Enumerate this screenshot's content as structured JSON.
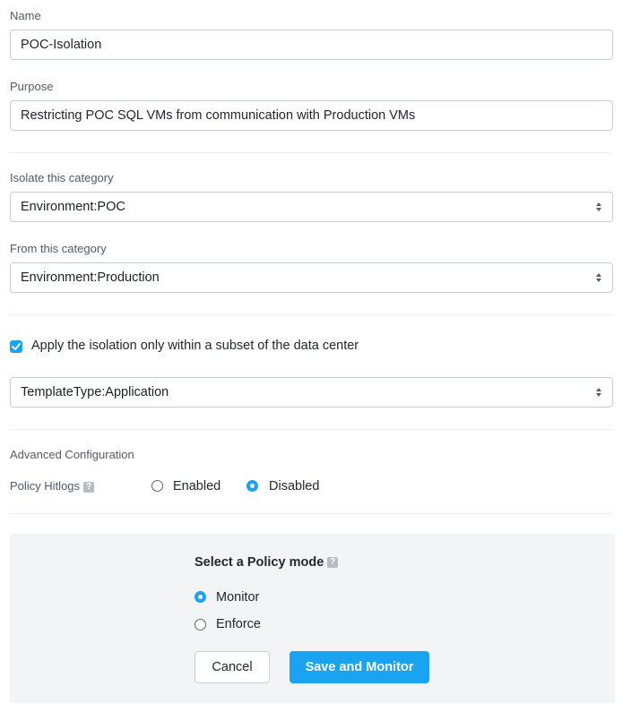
{
  "name": {
    "label": "Name",
    "value": "POC-Isolation"
  },
  "purpose": {
    "label": "Purpose",
    "value": "Restricting POC SQL VMs from communication with Production VMs"
  },
  "isolate": {
    "label": "Isolate this category",
    "value": "Environment:POC"
  },
  "from": {
    "label": "From this category",
    "value": "Environment:Production"
  },
  "subset": {
    "checked": true,
    "label": "Apply the isolation only within a subset of the data center",
    "value": "TemplateType:Application"
  },
  "advanced": {
    "heading": "Advanced Configuration",
    "hitlogs_label": "Policy Hitlogs",
    "help_icon": "question-icon",
    "options": [
      {
        "label": "Enabled",
        "selected": false
      },
      {
        "label": "Disabled",
        "selected": true
      }
    ]
  },
  "policy_mode": {
    "title": "Select a Policy mode",
    "options": [
      {
        "label": "Monitor",
        "selected": true
      },
      {
        "label": "Enforce",
        "selected": false
      }
    ],
    "cancel_label": "Cancel",
    "save_label": "Save and Monitor"
  },
  "colors": {
    "accent": "#1aa3f0",
    "panel_bg": "#f2f4f6",
    "border": "#c9ced6"
  }
}
